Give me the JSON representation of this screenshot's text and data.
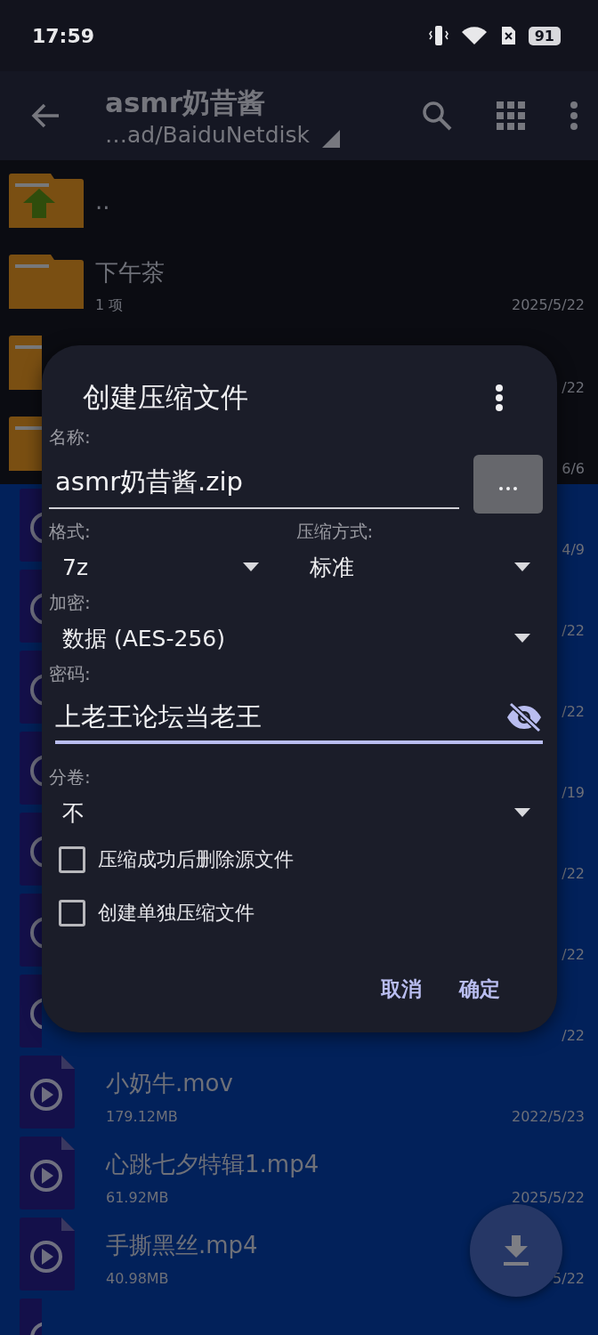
{
  "status_bar": {
    "time": "17:59",
    "battery": "91"
  },
  "app_bar": {
    "title": "asmr奶昔酱",
    "subtitle": "…ad/BaiduNetdisk"
  },
  "files": [
    {
      "kind": "parent",
      "name": "..",
      "selected": false
    },
    {
      "kind": "folder",
      "name": "下午茶",
      "info": "1 项",
      "date": "2025/5/22",
      "selected": false
    },
    {
      "kind": "folder",
      "date": "/22",
      "selected": false
    },
    {
      "kind": "folder",
      "date": "6/6",
      "selected": false
    },
    {
      "kind": "video",
      "date": "4/9",
      "selected": true
    },
    {
      "kind": "video",
      "date": "/22",
      "selected": true
    },
    {
      "kind": "video",
      "date": "/22",
      "selected": true
    },
    {
      "kind": "video",
      "date": "/19",
      "selected": true
    },
    {
      "kind": "video",
      "date": "/22",
      "selected": true
    },
    {
      "kind": "video",
      "date": "/22",
      "selected": true
    },
    {
      "kind": "video",
      "date": "/22",
      "selected": true
    },
    {
      "kind": "video",
      "name": "小奶牛.mov",
      "info": "179.12MB",
      "date": "2022/5/23",
      "selected": true
    },
    {
      "kind": "video",
      "name": "心跳七夕特辑1.mp4",
      "info": "61.92MB",
      "date": "2025/5/22",
      "selected": true
    },
    {
      "kind": "video",
      "name": "手撕黑丝.mp4",
      "info": "40.98MB",
      "date": "5/22",
      "selected": true
    },
    {
      "kind": "video",
      "selected": true
    }
  ],
  "dialog": {
    "title": "创建压缩文件",
    "fields": [
      {
        "kind": "text",
        "label": "名称:",
        "value": "asmr奶昔酱.zip"
      },
      {
        "kind": "pair",
        "items": [
          {
            "label": "格式:",
            "value": "7z"
          },
          {
            "label": "压缩方式:",
            "value": "标准"
          }
        ]
      },
      {
        "kind": "dropdown",
        "label": "加密:",
        "value": "数据 (AES-256)"
      },
      {
        "kind": "password",
        "label": "密码:",
        "value": "上老王论坛当老王"
      },
      {
        "kind": "dropdown",
        "label": "分卷:",
        "value": "不"
      }
    ],
    "checkboxes": [
      {
        "label": "压缩成功后删除源文件",
        "checked": false
      },
      {
        "label": "创建单独压缩文件",
        "checked": false
      }
    ],
    "buttons": [
      "取消",
      "确定"
    ]
  }
}
